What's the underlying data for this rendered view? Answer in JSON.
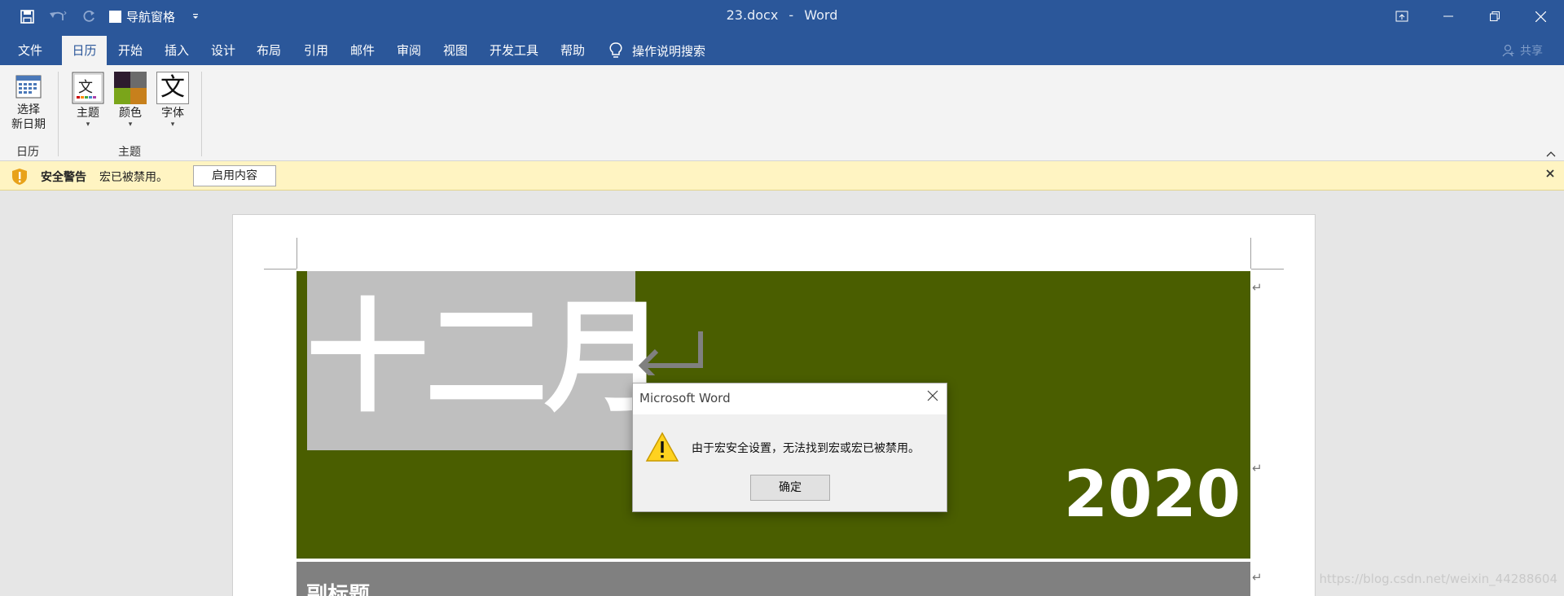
{
  "window": {
    "doc_name": "23.docx",
    "separator": "-",
    "app_name": "Word"
  },
  "qat": {
    "nav_pane_label": "导航窗格"
  },
  "tabs": [
    {
      "label": "文件"
    },
    {
      "label": "日历"
    },
    {
      "label": "开始"
    },
    {
      "label": "插入"
    },
    {
      "label": "设计"
    },
    {
      "label": "布局"
    },
    {
      "label": "引用"
    },
    {
      "label": "邮件"
    },
    {
      "label": "审阅"
    },
    {
      "label": "视图"
    },
    {
      "label": "开发工具"
    },
    {
      "label": "帮助"
    }
  ],
  "active_tab": "日历",
  "tell_me": "操作说明搜索",
  "share": "共享",
  "ribbon": {
    "calendar_group": {
      "button_line1": "选择",
      "button_line2": "新日期",
      "label": "日历"
    },
    "theme_group": {
      "theme": "主题",
      "colors": "颜色",
      "fonts": "字体",
      "fonts_glyph": "文",
      "label": "主题"
    }
  },
  "security": {
    "title": "安全警告",
    "message": "宏已被禁用。",
    "button": "启用内容"
  },
  "document": {
    "month": "十二月",
    "year": "2020",
    "subtitle": "副标题",
    "para_mark": "↵"
  },
  "dialog": {
    "title": "Microsoft Word",
    "message": "由于宏安全设置，无法找到宏或宏已被禁用。",
    "ok": "确定"
  },
  "watermark": "https://blog.csdn.net/weixin_44288604",
  "colors": {
    "brand": "#2b579a",
    "hero_bg": "#4a5e00",
    "title_block": "#bfbfbf",
    "subtitle_band": "#808080",
    "security_bar": "#fff4c2"
  }
}
